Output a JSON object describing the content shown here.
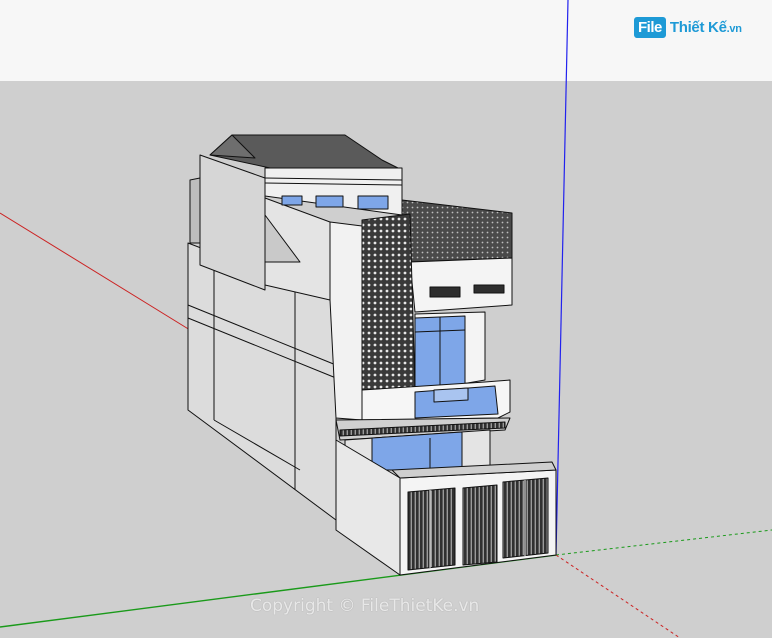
{
  "logo": {
    "mark": "File",
    "rest": "Thiết Kế",
    "tld": ".vn"
  },
  "watermark": {
    "text": "Copyright © FileThietKe.vn"
  },
  "colors": {
    "sky": "#f7f7f7",
    "ground": "#cfcfcf",
    "axis_red": "#cc2222",
    "axis_green": "#1a9a1a",
    "axis_blue": "#2222ee",
    "glass": "#7ea6e8",
    "wall_light": "#f1f1f1",
    "wall_side": "#d9d9d9",
    "roof": "#5a5a5a"
  },
  "icons": {
    "logo": "file-thiet-ke-logo"
  }
}
